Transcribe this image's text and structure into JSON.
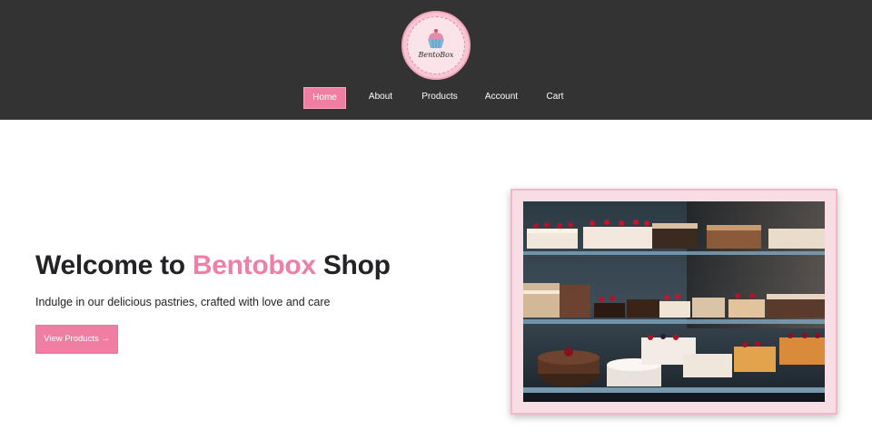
{
  "logo": {
    "script_text": "BentoBox",
    "icon": "cupcake-icon",
    "colors": {
      "circle": "#f7c6d3",
      "cupcake_top": "#e98aa6",
      "cupcake_base": "#7bb6d6"
    }
  },
  "nav": {
    "items": [
      {
        "label": "Home",
        "active": true
      },
      {
        "label": "About",
        "active": false
      },
      {
        "label": "Products",
        "active": false
      },
      {
        "label": "Account",
        "active": false
      },
      {
        "label": "Cart",
        "active": false
      }
    ]
  },
  "hero": {
    "title_prefix": "Welcome to ",
    "title_brand": "Bentobox",
    "title_suffix": " Shop",
    "subtitle": "Indulge in our delicious pastries, crafted with love and care",
    "cta_label": "View Products →"
  },
  "theme": {
    "header_bg": "#333333",
    "accent": "#f07ea3",
    "brand_text": "#ef7fa4",
    "frame_bg": "#f9dde5"
  },
  "image": {
    "subject": "bakery display case with cakes and pastries"
  }
}
